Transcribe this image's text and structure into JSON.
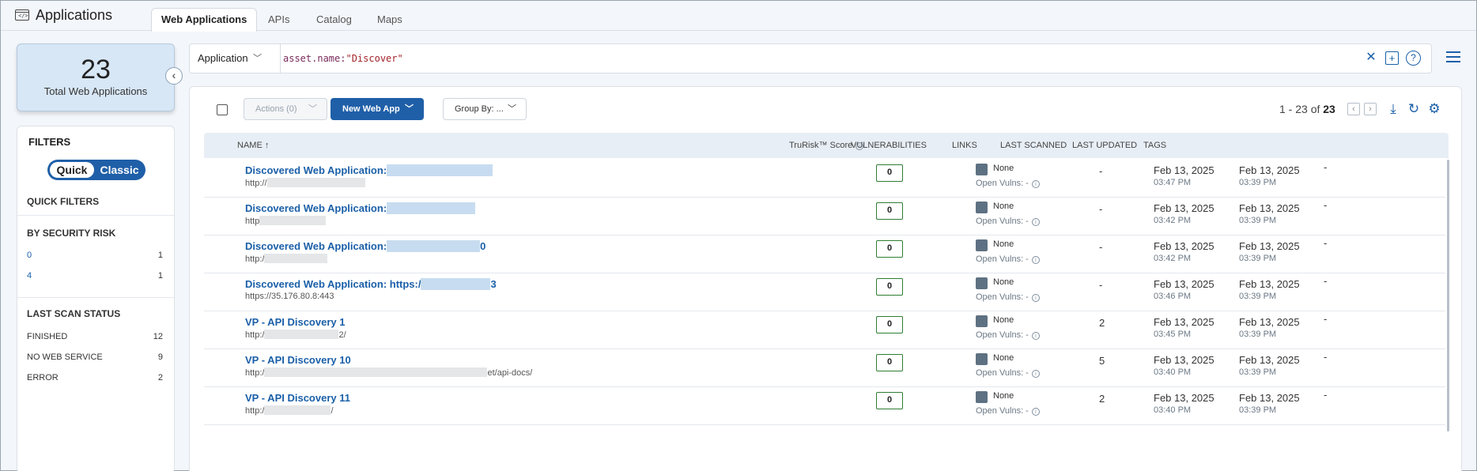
{
  "header": {
    "title": "Applications",
    "tabs": [
      {
        "label": "Web Applications",
        "active": true
      },
      {
        "label": "APIs",
        "active": false
      },
      {
        "label": "Catalog",
        "active": false
      },
      {
        "label": "Maps",
        "active": false
      }
    ]
  },
  "summary": {
    "count": "23",
    "label": "Total Web Applications"
  },
  "filters": {
    "title": "FILTERS",
    "toggle": {
      "quick": "Quick",
      "classic": "Classic",
      "selected": "Quick"
    },
    "quick_filters_title": "QUICK FILTERS",
    "security_risk": {
      "title": "BY SECURITY RISK",
      "items": [
        {
          "label": "0",
          "count": "1"
        },
        {
          "label": "4",
          "count": "1"
        }
      ]
    },
    "scan_status": {
      "title": "LAST SCAN STATUS",
      "items": [
        {
          "label": "FINISHED",
          "count": "12"
        },
        {
          "label": "NO WEB SERVICE",
          "count": "9"
        },
        {
          "label": "ERROR",
          "count": "2"
        }
      ]
    }
  },
  "search": {
    "scope": "Application",
    "query_key": "asset.name:",
    "query_value": "\"Discover\""
  },
  "toolbar": {
    "actions_label": "Actions (0)",
    "new_label": "New Web App",
    "groupby_label": "Group By: ...",
    "pagination_prefix": "1 - 23 of",
    "pagination_total": "23"
  },
  "table": {
    "headers": {
      "name": "NAME ↑",
      "score": "TruRisk™ Score",
      "vulns": "VULNERABILITIES",
      "links": "LINKS",
      "last_scanned": "LAST SCANNED",
      "last_updated": "LAST UPDATED",
      "tags": "TAGS"
    },
    "rows": [
      {
        "name": "Discovered Web Application:",
        "url": "http://",
        "score": "0",
        "vuln": "None",
        "open_vulns": "Open Vulns: -",
        "links": "-",
        "scan_date": "Feb 13, 2025",
        "scan_time": "03:47 PM",
        "upd_date": "Feb 13, 2025",
        "upd_time": "03:39 PM",
        "tags": "-"
      },
      {
        "name": "Discovered Web Application:",
        "url": "http",
        "score": "0",
        "vuln": "None",
        "open_vulns": "Open Vulns: -",
        "links": "-",
        "scan_date": "Feb 13, 2025",
        "scan_time": "03:42 PM",
        "upd_date": "Feb 13, 2025",
        "upd_time": "03:39 PM",
        "tags": "-"
      },
      {
        "name": "Discovered Web Application:",
        "name_suffix": "0",
        "url": "http:/",
        "score": "0",
        "vuln": "None",
        "open_vulns": "Open Vulns: -",
        "links": "-",
        "scan_date": "Feb 13, 2025",
        "scan_time": "03:42 PM",
        "upd_date": "Feb 13, 2025",
        "upd_time": "03:39 PM",
        "tags": "-"
      },
      {
        "name": "Discovered Web Application: https:/",
        "name_suffix": "3",
        "url": "https://35.176.80.8:443",
        "score": "0",
        "vuln": "None",
        "open_vulns": "Open Vulns: -",
        "links": "-",
        "scan_date": "Feb 13, 2025",
        "scan_time": "03:46 PM",
        "upd_date": "Feb 13, 2025",
        "upd_time": "03:39 PM",
        "tags": "-"
      },
      {
        "name": "VP - API Discovery 1",
        "url": "http:/",
        "url_suffix": "2/",
        "score": "0",
        "vuln": "None",
        "open_vulns": "Open Vulns: -",
        "links": "2",
        "scan_date": "Feb 13, 2025",
        "scan_time": "03:45 PM",
        "upd_date": "Feb 13, 2025",
        "upd_time": "03:39 PM",
        "tags": "-"
      },
      {
        "name": "VP - API Discovery 10",
        "url": "http:/",
        "url_suffix": "et/api-docs/",
        "score": "0",
        "vuln": "None",
        "open_vulns": "Open Vulns: -",
        "links": "5",
        "scan_date": "Feb 13, 2025",
        "scan_time": "03:40 PM",
        "upd_date": "Feb 13, 2025",
        "upd_time": "03:39 PM",
        "tags": "-"
      },
      {
        "name": "VP - API Discovery 11",
        "url": "http:/",
        "url_suffix": "/",
        "score": "0",
        "vuln": "None",
        "open_vulns": "Open Vulns: -",
        "links": "2",
        "scan_date": "Feb 13, 2025",
        "scan_time": "03:40 PM",
        "upd_date": "Feb 13, 2025",
        "upd_time": "03:39 PM",
        "tags": "-"
      }
    ]
  }
}
